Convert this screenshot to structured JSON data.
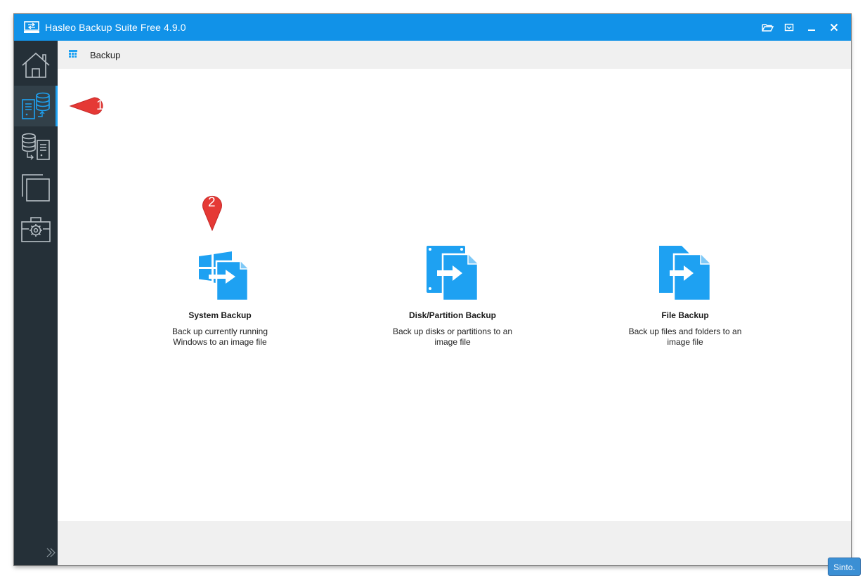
{
  "window": {
    "title": "Hasleo Backup Suite Free 4.9.0"
  },
  "titlebar": {
    "buttons": [
      "folder-open-icon",
      "menu-icon",
      "minimize-icon",
      "close-icon"
    ]
  },
  "sidebar": {
    "items": [
      {
        "name": "home",
        "icon": "home-icon",
        "active": false
      },
      {
        "name": "backup",
        "icon": "backup-icon",
        "active": true
      },
      {
        "name": "restore",
        "icon": "restore-icon",
        "active": false
      },
      {
        "name": "clone",
        "icon": "clone-icon",
        "active": false
      },
      {
        "name": "tools",
        "icon": "toolbox-icon",
        "active": false
      }
    ]
  },
  "header": {
    "title": "Backup"
  },
  "options": [
    {
      "title": "System Backup",
      "desc": "Back up currently running Windows to an image file"
    },
    {
      "title": "Disk/Partition Backup",
      "desc": "Back up disks or partitions to an image file"
    },
    {
      "title": "File Backup",
      "desc": "Back up files and folders to an image file"
    }
  ],
  "annotations": {
    "one": "1",
    "two": "2"
  },
  "badge": {
    "text": "Sinto."
  },
  "colors": {
    "titlebar": "#1192e8",
    "sidebar": "#253038",
    "accent": "#1ea1f2",
    "callout": "#e53935"
  }
}
